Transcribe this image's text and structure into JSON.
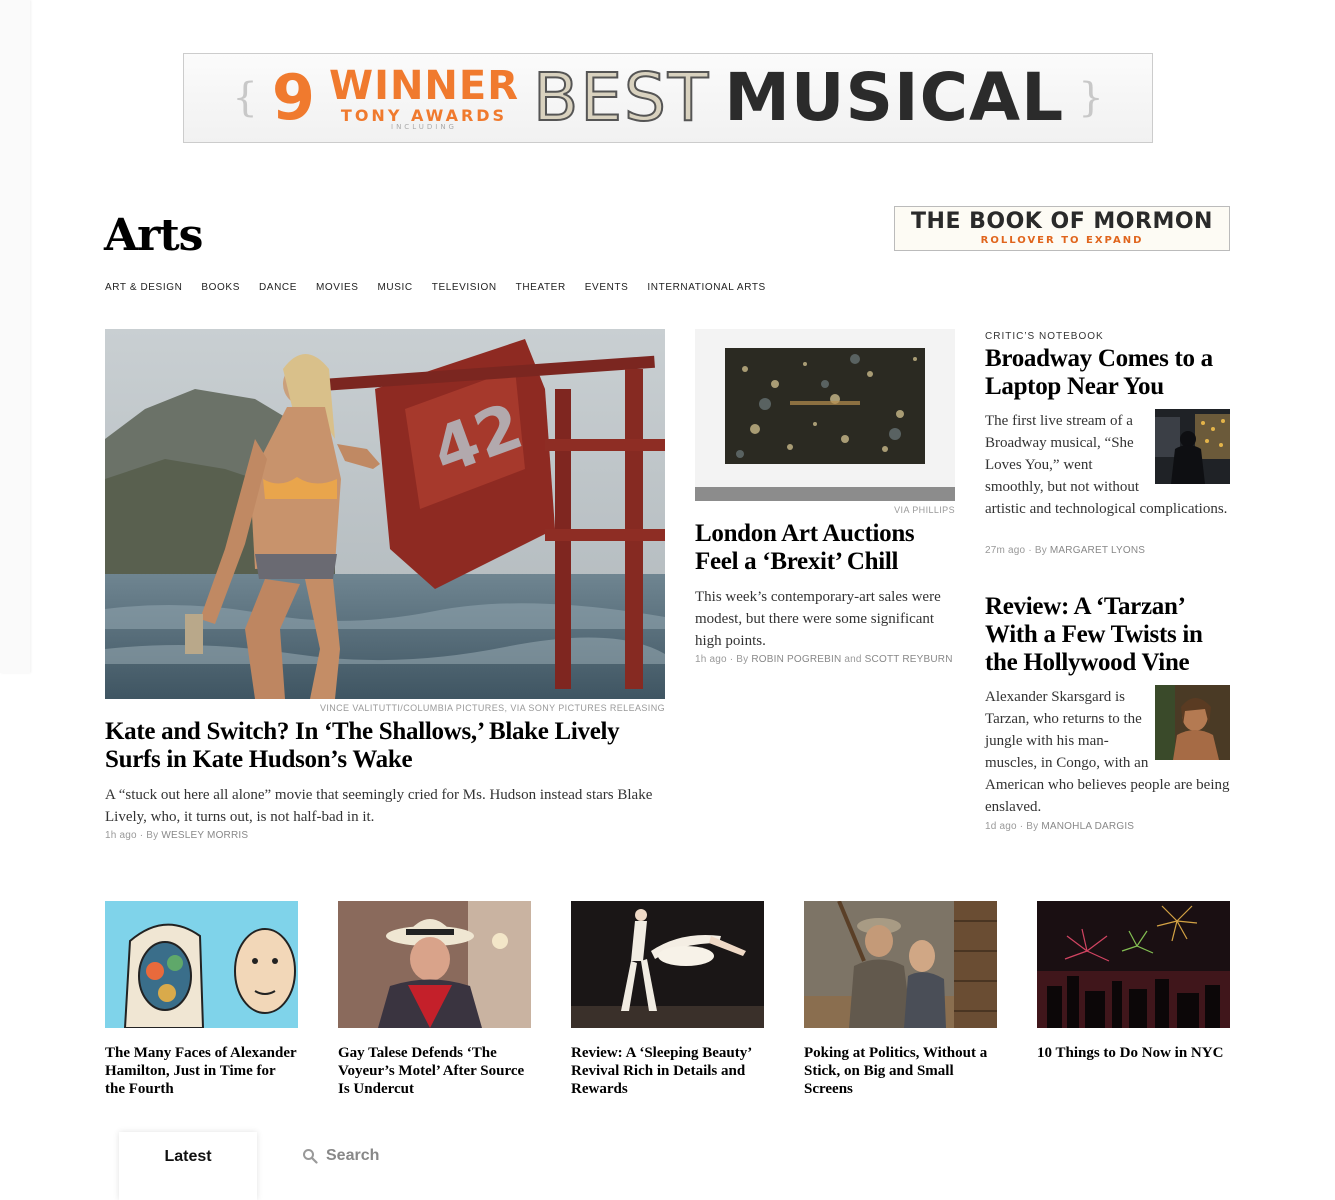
{
  "top_ad": {
    "number": "9",
    "winner": "WINNER",
    "tony": "TONY AWARDS",
    "including": "INCLUDING",
    "best": "BEST",
    "musical": "MUSICAL"
  },
  "section": {
    "title": "Arts"
  },
  "side_ad": {
    "title": "THE BOOK OF MORMON",
    "subtitle": "ROLLOVER TO EXPAND"
  },
  "subnav": [
    "ART & DESIGN",
    "BOOKS",
    "DANCE",
    "MOVIES",
    "MUSIC",
    "TELEVISION",
    "THEATER",
    "EVENTS",
    "INTERNATIONAL ARTS"
  ],
  "lead": {
    "credit": "VINCE VALITUTTI/COLUMBIA PICTURES, VIA SONY PICTURES RELEASING",
    "headline": "Kate and Switch? In ‘The Shallows,’ Blake Lively Surfs in Kate Hudson’s Wake",
    "summary": "A “stuck out here all alone” movie that seemingly cried for Ms. Hudson instead stars Blake Lively, who, it turns out, is not half-bad in it.",
    "time": "1h ago",
    "by_prefix": "By",
    "author": "WESLEY MORRIS"
  },
  "middle": {
    "credit": "VIA PHILLIPS",
    "headline": "London Art Auctions Feel a ‘Brexit’ Chill",
    "summary": "This week’s contemporary-art sales were modest, but there were some significant high points.",
    "time": "1h ago",
    "by_prefix": "By",
    "author1": "ROBIN POGREBIN",
    "and": "and",
    "author2": "SCOTT REYBURN"
  },
  "right1": {
    "kicker": "CRITIC’S NOTEBOOK",
    "headline": "Broadway Comes to a Laptop Near You",
    "summary": "The first live stream of a Broadway musical, “She Loves You,” went smoothly, but not without artistic and technological complications.",
    "time": "27m ago",
    "by_prefix": "By",
    "author": "MARGARET LYONS"
  },
  "right2": {
    "headline": "Review: A ‘Tarzan’ With a Few Twists in the Hollywood Vine",
    "summary": "Alexander Skarsgard is Tarzan, who returns to the jungle with his man-muscles, in Congo, with an American who believes people are being enslaved.",
    "time": "1d ago",
    "by_prefix": "By",
    "author": "MANOHLA DARGIS"
  },
  "cards": [
    {
      "title": "The Many Faces of Alexander Hamilton, Just in Time for the Fourth"
    },
    {
      "title": "Gay Talese Defends ‘The Voyeur’s Motel’ After Source Is Undercut"
    },
    {
      "title": "Review: A ‘Sleeping Beauty’ Revival Rich in Details and Rewards"
    },
    {
      "title": "Poking at Politics, Without a Stick, on Big and Small Screens"
    },
    {
      "title": "10 Things to Do Now in NYC"
    }
  ],
  "bottom_tabs": {
    "latest": "Latest",
    "search": "Search"
  },
  "icons": {
    "search": "search-icon",
    "sep": "·"
  },
  "colors": {
    "ad_orange": "#f07a2e",
    "byline_gray": "#999999"
  }
}
